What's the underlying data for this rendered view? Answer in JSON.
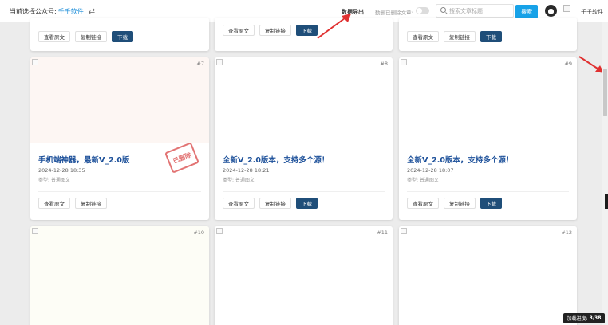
{
  "topbar": {
    "account_label": "当前选择公众号:",
    "account_name": "千千软件",
    "swap_icon": "swap-icon",
    "export_label": "数据导出",
    "toggle_label": "勤删已删除文章:",
    "search_placeholder": "搜索文章标题",
    "search_button": "搜索",
    "user_name": "千千软件"
  },
  "top_cards": [
    {
      "btn_view": "查看原文",
      "btn_copy": "复制链接",
      "btn_download": "下载"
    },
    {
      "btn_view": "查看原文",
      "btn_copy": "复制链接",
      "btn_download": "下载"
    },
    {
      "btn_view": "查看原文",
      "btn_copy": "复制链接",
      "btn_download": "下载"
    }
  ],
  "cards": [
    {
      "num": "#7",
      "title": "手机端神器，最新V_2.0版",
      "date": "2024-12-28 18:35",
      "category": "类型: 普通图文",
      "btn_view": "查看原文",
      "btn_copy": "复制链接",
      "btn_download": "下载",
      "stamp": "已删除",
      "img_color": "#fdf6f3"
    },
    {
      "num": "#8",
      "title": "全新V_2.0版本，支持多个源！",
      "date": "2024-12-28 18:21",
      "category": "类型: 普通图文",
      "btn_view": "查看原文",
      "btn_copy": "复制链接",
      "btn_download": "下载",
      "img_color": "#ffffff"
    },
    {
      "num": "#9",
      "title": "全新V_2.0版本，支持多个源！",
      "date": "2024-12-28 18:07",
      "category": "类型: 普通图文",
      "btn_view": "查看原文",
      "btn_copy": "复制链接",
      "btn_download": "下载",
      "img_color": "#ffffff"
    }
  ],
  "bottom_cards": [
    {
      "num": "#10",
      "img_color": "#fdfdf6"
    },
    {
      "num": "#11",
      "img_color": "#ffffff"
    },
    {
      "num": "#12",
      "img_color": "#ffffff"
    }
  ],
  "progress": {
    "label": "加载进度:",
    "value": "3/38"
  },
  "colors": {
    "accent": "#17a2e8",
    "download": "#1f4e79",
    "title": "#1b4f99",
    "arrow": "#e03030",
    "stamp": "#dd5b5b"
  }
}
